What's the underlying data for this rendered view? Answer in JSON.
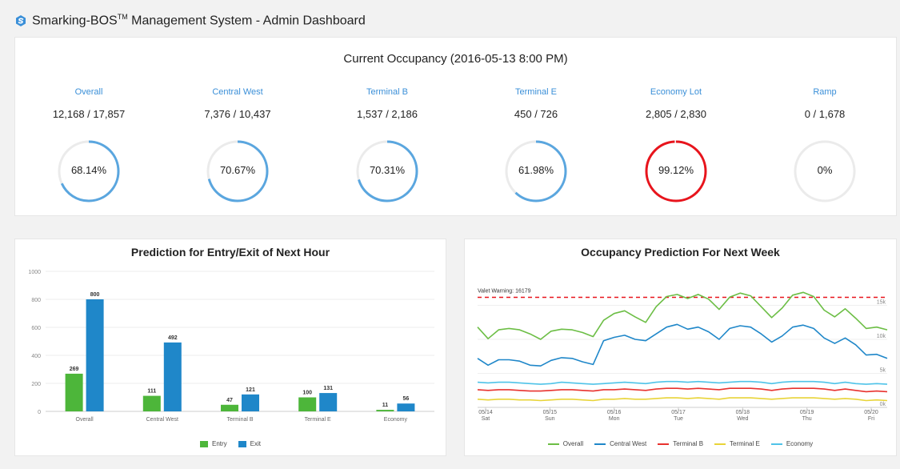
{
  "header": {
    "title_main": "Smarking-BOS",
    "title_sup": "TM",
    "title_rest": " Management System - Admin Dashboard",
    "logo_icon": "smarking-logo-icon",
    "logo_color": "#3a8fd8"
  },
  "occupancy": {
    "title": "Current Occupancy (2016-05-13 8:00 PM)",
    "items": [
      {
        "name": "Overall",
        "value": "12,168 / 17,857",
        "pct_label": "68.14%",
        "pct": 0.6814,
        "color": "#5aa6df"
      },
      {
        "name": "Central West",
        "value": "7,376 / 10,437",
        "pct_label": "70.67%",
        "pct": 0.7067,
        "color": "#5aa6df"
      },
      {
        "name": "Terminal B",
        "value": "1,537 / 2,186",
        "pct_label": "70.31%",
        "pct": 0.7031,
        "color": "#5aa6df"
      },
      {
        "name": "Terminal E",
        "value": "450 / 726",
        "pct_label": "61.98%",
        "pct": 0.6198,
        "color": "#5aa6df"
      },
      {
        "name": "Economy Lot",
        "value": "2,805 / 2,830",
        "pct_label": "99.12%",
        "pct": 0.9912,
        "color": "#e8141c"
      },
      {
        "name": "Ramp",
        "value": "0 / 1,678",
        "pct_label": "0%",
        "pct": 0,
        "color": "#5aa6df"
      }
    ]
  },
  "entry_chart": {
    "title": "Prediction for Entry/Exit of Next Hour",
    "chart_data": {
      "type": "bar",
      "categories": [
        "Overall",
        "Central West",
        "Terminal B",
        "Terminal E",
        "Economy"
      ],
      "series": [
        {
          "name": "Entry",
          "values": [
            269,
            111,
            47,
            100,
            11
          ],
          "color": "#4db63a"
        },
        {
          "name": "Exit",
          "values": [
            800,
            492,
            121,
            131,
            56
          ],
          "color": "#1f87c9"
        }
      ],
      "ylim": [
        0,
        1000
      ],
      "yticks": [
        "0",
        "200",
        "400",
        "600",
        "800",
        "1000"
      ],
      "grid": true,
      "legend": "bottom"
    }
  },
  "week_chart": {
    "title": "Occupancy Prediction For Next Week",
    "warning_label": "Valet Warning: 16179",
    "chart_data": {
      "type": "line",
      "x_ticks": [
        {
          "date": "05/14",
          "day": "Sat"
        },
        {
          "date": "05/15",
          "day": "Sun"
        },
        {
          "date": "05/16",
          "day": "Mon"
        },
        {
          "date": "05/17",
          "day": "Tue"
        },
        {
          "date": "05/18",
          "day": "Wed"
        },
        {
          "date": "05/19",
          "day": "Thu"
        },
        {
          "date": "05/20",
          "day": "Fri"
        }
      ],
      "y_ticks": [
        "0k",
        "5k",
        "10k",
        "15k"
      ],
      "ylim": [
        0,
        20000
      ],
      "valet_warning": 16179,
      "series": [
        {
          "name": "Overall",
          "color": "#6cbe45",
          "values": [
            11800,
            10100,
            11400,
            11600,
            11400,
            10800,
            10000,
            11200,
            11500,
            11400,
            11000,
            10400,
            12800,
            13800,
            14200,
            13300,
            12500,
            14800,
            16300,
            16600,
            16000,
            16600,
            15900,
            14400,
            16200,
            16800,
            16400,
            14800,
            13200,
            14600,
            16500,
            16900,
            16300,
            14300,
            13300,
            14500,
            13100,
            11600,
            11800,
            11400
          ]
        },
        {
          "name": "Central West",
          "color": "#1f87c9",
          "values": [
            7200,
            6200,
            7000,
            7000,
            6800,
            6200,
            6100,
            6900,
            7300,
            7200,
            6700,
            6300,
            9800,
            10300,
            10600,
            10000,
            9800,
            10800,
            11800,
            12200,
            11500,
            11800,
            11100,
            10000,
            11600,
            12000,
            11800,
            10800,
            9600,
            10500,
            11800,
            12100,
            11600,
            10200,
            9400,
            10200,
            9200,
            7700,
            7800,
            7200
          ]
        },
        {
          "name": "Terminal B",
          "color": "#e8322e",
          "values": [
            2600,
            2500,
            2600,
            2600,
            2500,
            2400,
            2400,
            2500,
            2600,
            2600,
            2500,
            2400,
            2600,
            2600,
            2700,
            2600,
            2500,
            2700,
            2800,
            2800,
            2700,
            2800,
            2700,
            2600,
            2800,
            2800,
            2800,
            2700,
            2500,
            2700,
            2800,
            2800,
            2800,
            2700,
            2500,
            2700,
            2500,
            2300,
            2400,
            2300
          ]
        },
        {
          "name": "Terminal E",
          "color": "#e8d438",
          "values": [
            1200,
            1100,
            1200,
            1200,
            1100,
            1100,
            1000,
            1100,
            1200,
            1200,
            1100,
            1000,
            1200,
            1200,
            1300,
            1200,
            1200,
            1300,
            1400,
            1400,
            1300,
            1400,
            1300,
            1200,
            1400,
            1400,
            1400,
            1300,
            1200,
            1300,
            1400,
            1400,
            1400,
            1300,
            1200,
            1300,
            1200,
            1000,
            1100,
            1000
          ]
        },
        {
          "name": "Economy",
          "color": "#4fc3e8",
          "values": [
            3700,
            3600,
            3700,
            3700,
            3600,
            3500,
            3400,
            3500,
            3700,
            3600,
            3500,
            3400,
            3500,
            3600,
            3700,
            3600,
            3500,
            3700,
            3800,
            3800,
            3700,
            3800,
            3700,
            3600,
            3700,
            3800,
            3800,
            3700,
            3500,
            3700,
            3800,
            3800,
            3800,
            3700,
            3500,
            3700,
            3500,
            3400,
            3500,
            3400
          ]
        }
      ],
      "grid": true,
      "legend": "bottom"
    }
  }
}
